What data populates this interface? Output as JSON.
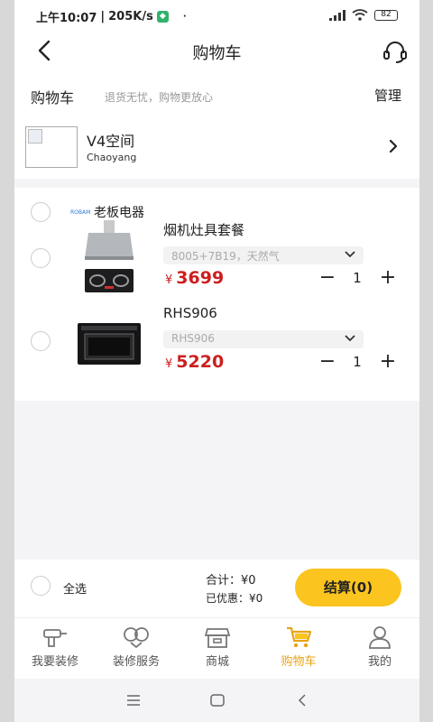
{
  "status_bar": {
    "time": "上午10:07",
    "speed": "205K/s",
    "dot": "·",
    "battery": "82"
  },
  "header": {
    "title": "购物车",
    "back_icon": "back-arrow-icon",
    "service_icon": "headset-icon"
  },
  "subheader": {
    "cart_label": "购物车",
    "tagline": "退货无忧，购物更放心",
    "manage_label": "管理"
  },
  "space": {
    "name": "V4空间",
    "area": "Chaoyang"
  },
  "brand": {
    "logo_text": "ROBAM",
    "name": "老板电器"
  },
  "items": [
    {
      "name": "烟机灶具套餐",
      "spec": "8005+7B19，天然气",
      "currency": "¥",
      "price": "3699",
      "quantity": "1",
      "minus": "−",
      "plus": "+"
    },
    {
      "name": "RHS906",
      "spec": "RHS906",
      "currency": "¥",
      "price": "5220",
      "quantity": "1",
      "minus": "−",
      "plus": "+"
    }
  ],
  "summary": {
    "select_all": "全选",
    "total_label": "合计：",
    "total_value": "¥0",
    "discount_label": "已优惠：",
    "discount_value": "¥0",
    "checkout_label": "结算(0)"
  },
  "tabs": [
    {
      "label": "我要装修",
      "icon": "drill-icon"
    },
    {
      "label": "装修服务",
      "icon": "service-mask-icon"
    },
    {
      "label": "商城",
      "icon": "store-icon"
    },
    {
      "label": "购物车",
      "icon": "cart-icon",
      "active": true
    },
    {
      "label": "我的",
      "icon": "profile-icon"
    }
  ],
  "colors": {
    "accent": "#fbc41e",
    "active_tab": "#e8a414",
    "price": "#cc1f1f"
  }
}
